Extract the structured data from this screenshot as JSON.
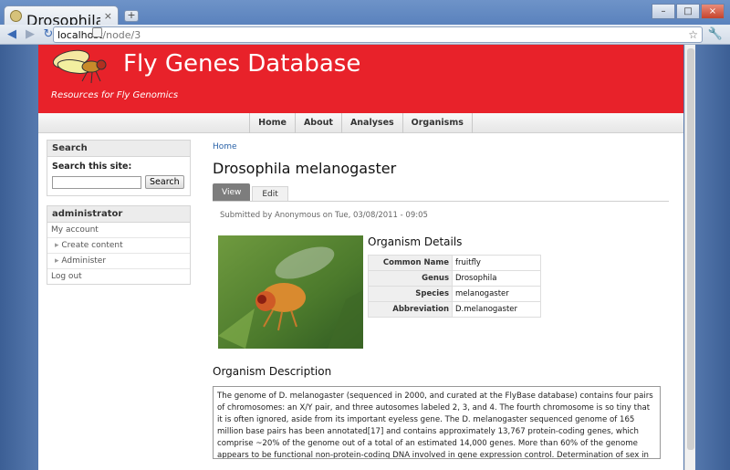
{
  "browser": {
    "tab_title": "Drosophila melanoga…",
    "tab_close": "×",
    "new_tab": "+",
    "url_host": "localhost",
    "url_path": "/node/3",
    "controls": [
      "–",
      "□",
      "×"
    ]
  },
  "site": {
    "name": "Fly Genes Database",
    "slogan": "Resources for Fly Genomics"
  },
  "nav": [
    "Home",
    "About",
    "Analyses",
    "Organisms"
  ],
  "sidebar": {
    "search_block_title": "Search",
    "search_label": "Search this site:",
    "search_button": "Search",
    "user_block_title": "administrator",
    "menu": [
      "My account",
      "Create content",
      "Administer",
      "Log out"
    ]
  },
  "content": {
    "breadcrumb": "Home",
    "title": "Drosophila melanogaster",
    "tabs": [
      "View",
      "Edit"
    ],
    "submitted": "Submitted by Anonymous on Tue, 03/08/2011 - 09:05",
    "details_title": "Organism Details",
    "details": [
      {
        "key": "Common Name",
        "value": "fruitfly"
      },
      {
        "key": "Genus",
        "value": "Drosophila"
      },
      {
        "key": "Species",
        "value": "melanogaster"
      },
      {
        "key": "Abbreviation",
        "value": "D.melanogaster"
      }
    ],
    "description_title": "Organism Description",
    "description": "The genome of D. melanogaster (sequenced in 2000, and curated at the FlyBase database) contains four pairs of chromosomes: an X/Y pair, and three autosomes labeled 2, 3, and 4. The fourth chromosome is so tiny that it is often ignored, aside from its important eyeless gene. The D. melanogaster sequenced genome of 165 million base pairs has been annotated[17] and contains approximately 13,767 protein-coding genes, which comprise ~20% of the genome out of a total of an estimated 14,000 genes. More than 60% of the genome appears to be functional non-protein-coding DNA involved in gene expression control. Determination of sex in Drosophila occurs by the ratio of X chromosomes to autosomes, not because of the presence of a Y chromosome as in human sex determination. Although the X chromosome is entirely heterochromatic"
  }
}
